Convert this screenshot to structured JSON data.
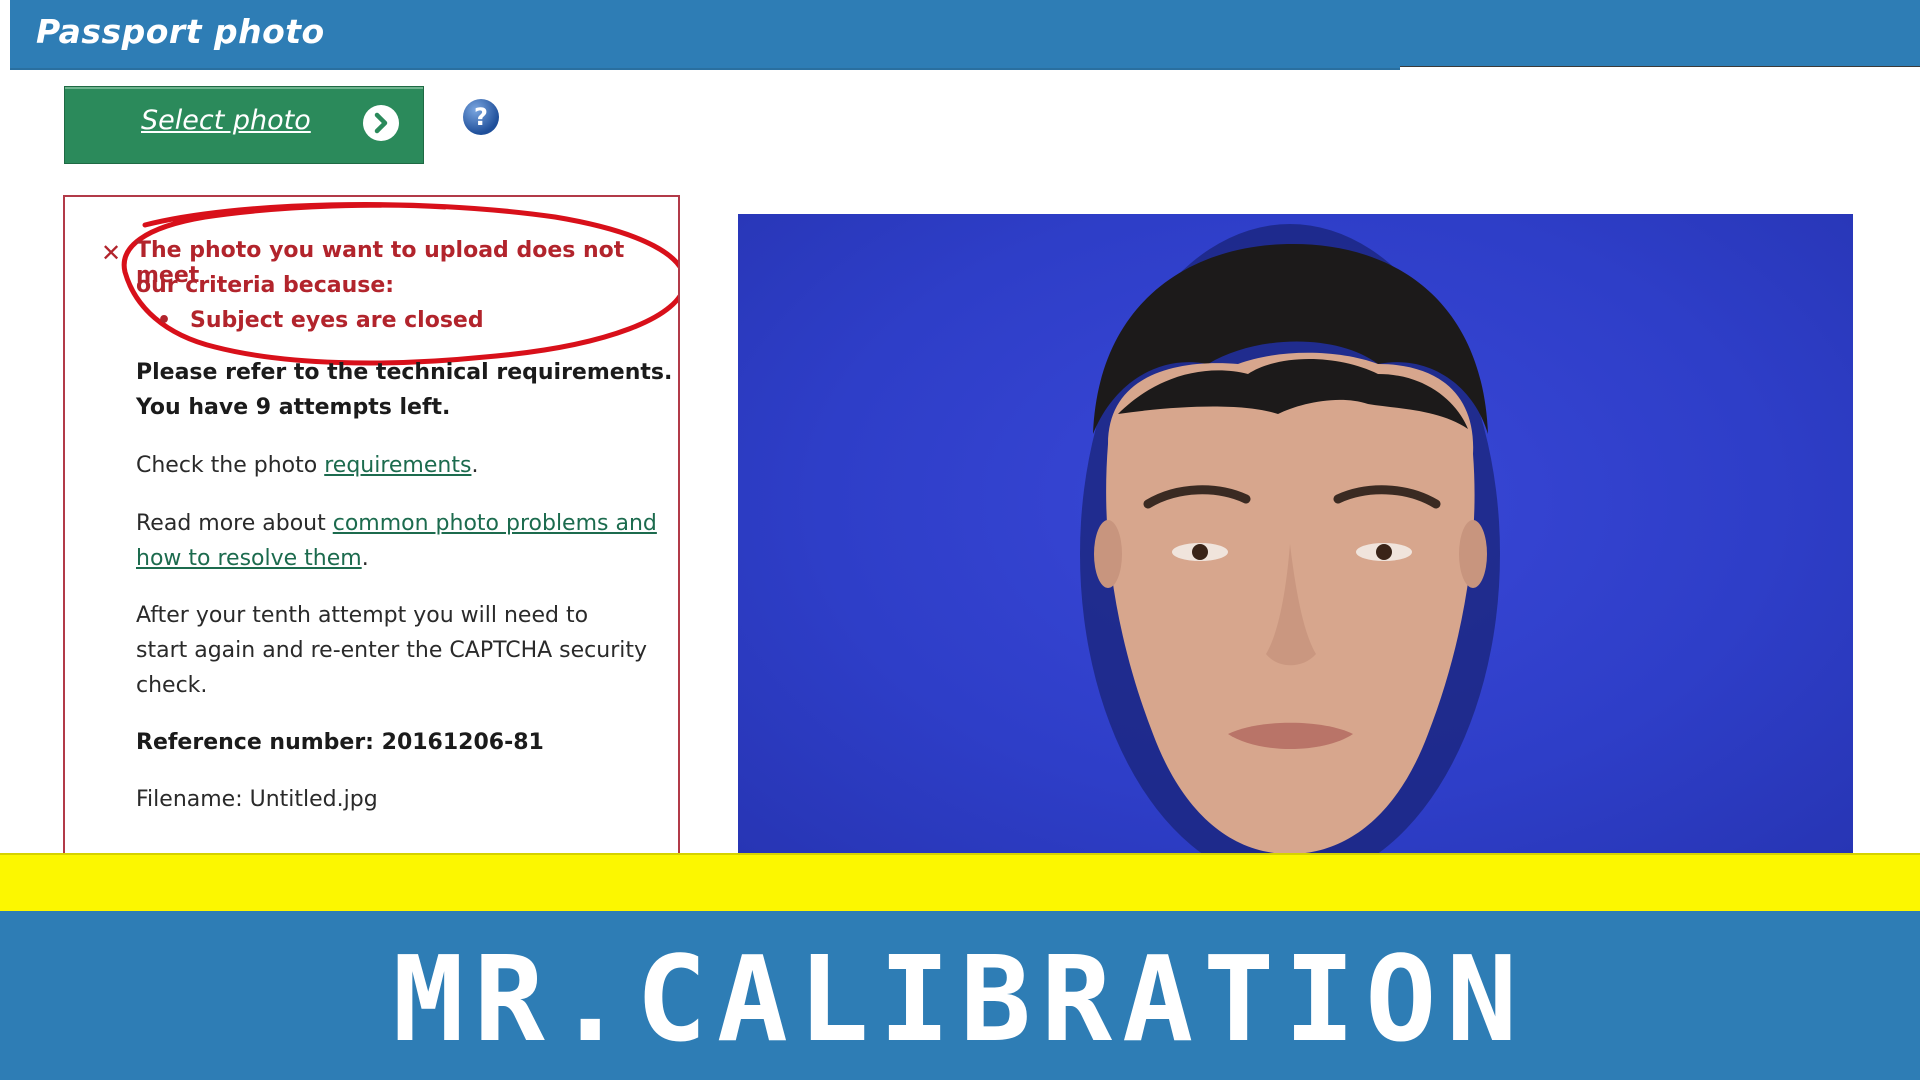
{
  "header": {
    "title": "Passport photo"
  },
  "toolbar": {
    "select_label": "Select photo",
    "help_glyph": "?"
  },
  "error": {
    "x_glyph": "✕",
    "line1": "The photo you want to upload does not meet",
    "line2": "our criteria because:",
    "bullet": "•",
    "reason": "Subject eyes are closed"
  },
  "notice": {
    "refer": "Please refer to the technical requirements.",
    "attempts": "You have 9 attempts left."
  },
  "check": {
    "prefix": "Check the photo ",
    "link": "requirements",
    "suffix": "."
  },
  "readmore": {
    "prefix": "Read more about ",
    "link1": "common photo problems and",
    "link2": "how to resolve them",
    "suffix": "."
  },
  "after": {
    "line1": "After your tenth attempt you will need to",
    "line2": "start again and re-enter the CAPTCHA security",
    "line3": "check."
  },
  "reference": "Reference number: 20161206-81",
  "filename": "Filename: Untitled.jpg",
  "brand": "MR.CALIBRATION",
  "colors": {
    "banner": "#2e7db5",
    "button": "#2b8a5b",
    "error": "#b2242c",
    "stripe": "#fcf700",
    "photo_bg": "#2e3ec8"
  },
  "icons": {
    "help": "help-icon",
    "arrow": "chevron-right-icon",
    "error": "close-icon"
  }
}
